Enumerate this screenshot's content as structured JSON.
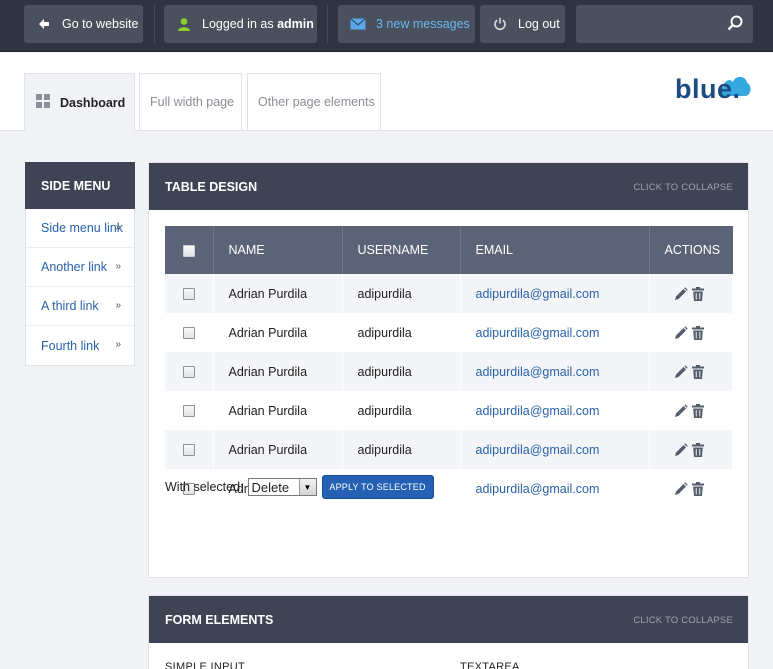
{
  "topbar": {
    "go_to_website": "Go to website",
    "logged_in_prefix": "Logged in as ",
    "logged_in_user": "admin",
    "messages": "3 new messages",
    "logout": "Log out",
    "search_placeholder": ""
  },
  "header": {
    "tabs": [
      {
        "label": "Dashboard",
        "active": true
      },
      {
        "label": "Full width page",
        "active": false
      },
      {
        "label": "Other page elements",
        "active": false
      }
    ],
    "logo": "blue."
  },
  "side_menu": {
    "title": "SIDE MENU",
    "items": [
      {
        "label": "Side menu link"
      },
      {
        "label": "Another link"
      },
      {
        "label": "A third link"
      },
      {
        "label": "Fourth link"
      }
    ]
  },
  "table_panel": {
    "title": "TABLE DESIGN",
    "collapse": "CLICK TO COLLAPSE",
    "columns": [
      "NAME",
      "USERNAME",
      "EMAIL",
      "ACTIONS"
    ],
    "rows": [
      {
        "name": "Adrian Purdila",
        "username": "adipurdila",
        "email": "adipurdila@gmail.com"
      },
      {
        "name": "Adrian Purdila",
        "username": "adipurdila",
        "email": "adipurdila@gmail.com"
      },
      {
        "name": "Adrian Purdila",
        "username": "adipurdila",
        "email": "adipurdila@gmail.com"
      },
      {
        "name": "Adrian Purdila",
        "username": "adipurdila",
        "email": "adipurdila@gmail.com"
      },
      {
        "name": "Adrian Purdila",
        "username": "adipurdila",
        "email": "adipurdila@gmail.com"
      },
      {
        "name": "Adrian Purdila",
        "username": "adipurdila",
        "email": "adipurdila@gmail.com"
      }
    ],
    "with_selected": "With selected:",
    "bulk_action": "Delete",
    "apply": "APPLY TO SELECTED"
  },
  "form_panel": {
    "title": "FORM ELEMENTS",
    "collapse": "CLICK TO COLLAPSE",
    "simple_input": "SIMPLE INPUT",
    "textarea": "TEXTAREA"
  },
  "colors": {
    "topbar": "#2f3440",
    "panel_header": "#3e4453",
    "table_header": "#5b6376",
    "link": "#2a62a8",
    "button": "#2460b4"
  }
}
